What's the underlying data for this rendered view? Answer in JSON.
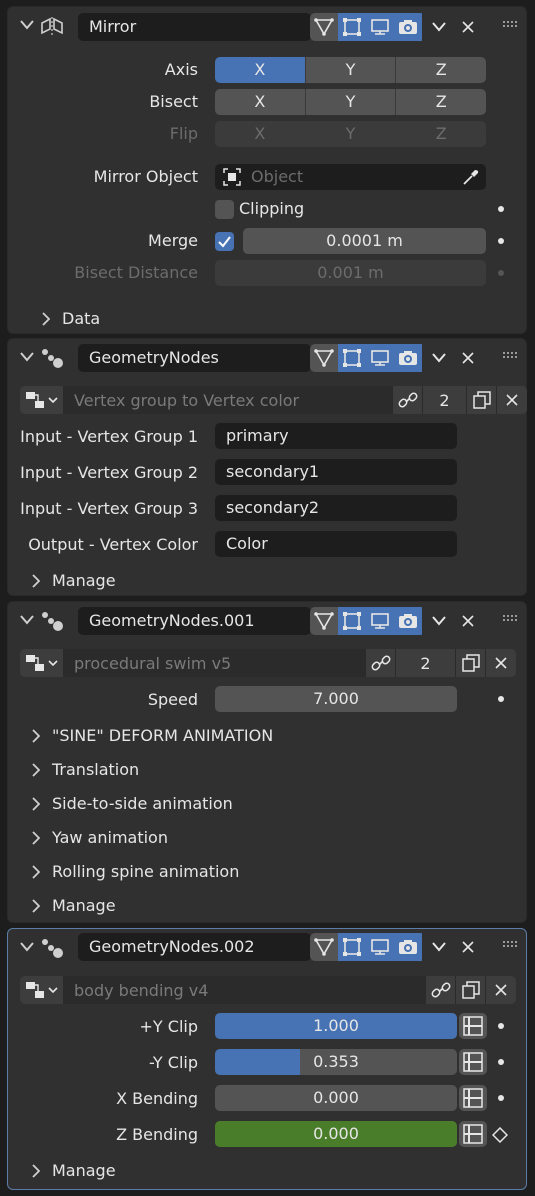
{
  "mirror": {
    "name": "Mirror",
    "axis_label": "Axis",
    "bisect_label": "Bisect",
    "flip_label": "Flip",
    "axis_opts": [
      "X",
      "Y",
      "Z"
    ],
    "bisect_opts": [
      "X",
      "Y",
      "Z"
    ],
    "flip_opts": [
      "X",
      "Y",
      "Z"
    ],
    "mirror_object_label": "Mirror Object",
    "mirror_object_placeholder": "Object",
    "clipping_label": "Clipping",
    "merge_label": "Merge",
    "merge_value": "0.0001 m",
    "bisect_distance_label": "Bisect Distance",
    "bisect_distance_value": "0.001 m",
    "data_label": "Data"
  },
  "gn1": {
    "name": "GeometryNodes",
    "node_group": "Vertex group to Vertex color",
    "users": "2",
    "inputs": [
      {
        "label": "Input - Vertex Group 1",
        "value": "primary"
      },
      {
        "label": "Input - Vertex Group 2",
        "value": "secondary1"
      },
      {
        "label": "Input - Vertex Group 3",
        "value": "secondary2"
      },
      {
        "label": "Output - Vertex Color",
        "value": "Color"
      }
    ],
    "manage_label": "Manage"
  },
  "gn2": {
    "name": "GeometryNodes.001",
    "node_group": "procedural swim v5",
    "users": "2",
    "speed_label": "Speed",
    "speed_value": "7.000",
    "panels": [
      "\"SINE\" DEFORM ANIMATION",
      "Translation",
      "Side-to-side animation",
      "Yaw animation",
      "Rolling spine animation",
      "Manage"
    ]
  },
  "gn3": {
    "name": "GeometryNodes.002",
    "node_group": "body bending v4",
    "params": [
      {
        "label": "+Y Clip",
        "value": "1.000",
        "fraction": 1.0
      },
      {
        "label": "-Y Clip",
        "value": "0.353",
        "fraction": 0.353
      },
      {
        "label": "X Bending",
        "value": "0.000",
        "fraction": 0
      },
      {
        "label": "Z Bending",
        "value": "0.000",
        "fraction": 1.0
      }
    ],
    "manage_label": "Manage"
  },
  "colors": {
    "accent": "#4772b3",
    "keyed": "#4a7d2a",
    "panel": "#303030",
    "background": "#1d1d1d"
  }
}
